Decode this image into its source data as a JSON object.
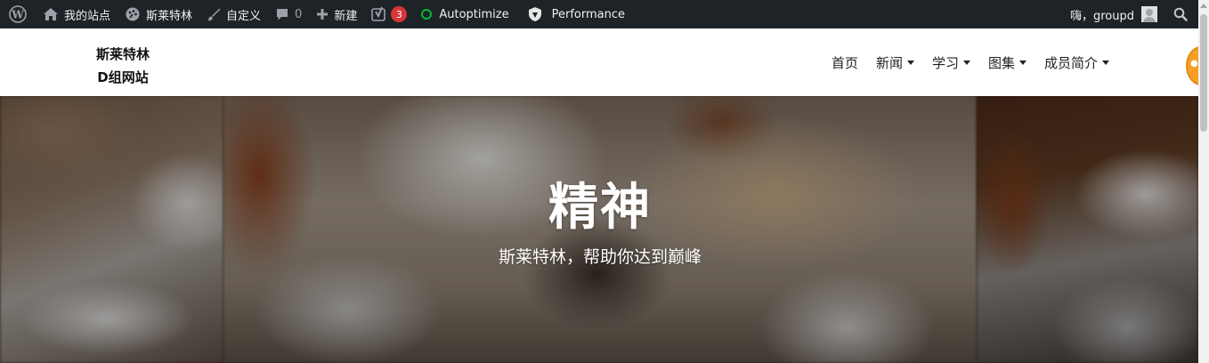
{
  "admin_bar": {
    "my_sites": "我的站点",
    "site_name": "斯莱特林",
    "customize": "自定义",
    "comments_count": "0",
    "new_label": "新建",
    "updates_count": "3",
    "autoptimize": "Autoptimize",
    "performance": "Performance",
    "greeting": "嗨，groupd",
    "icons": {
      "wp_logo": "wordpress-logo-icon",
      "my_sites": "dashboard-icon",
      "site": "palette-icon",
      "customize": "brush-icon",
      "comments": "comment-bubble-icon",
      "new": "plus-icon",
      "yoast": "yoast-seo-icon",
      "autoptimize": "status-ring-icon",
      "performance": "shield-icon",
      "avatar": "avatar-icon",
      "search": "search-icon"
    },
    "colors": {
      "background": "#1d2327",
      "badge": "#d63638",
      "status_ring": "#00ba37"
    }
  },
  "site": {
    "brand_line1": "斯莱特林",
    "brand_line2": "D组网站"
  },
  "nav": {
    "items": [
      {
        "label": "首页",
        "has_dropdown": false
      },
      {
        "label": "新闻",
        "has_dropdown": true
      },
      {
        "label": "学习",
        "has_dropdown": true
      },
      {
        "label": "图集",
        "has_dropdown": true
      },
      {
        "label": "成员简介",
        "has_dropdown": true
      }
    ]
  },
  "hero": {
    "title": "精神",
    "subtitle": "斯莱特林，帮助你达到巅峰"
  }
}
